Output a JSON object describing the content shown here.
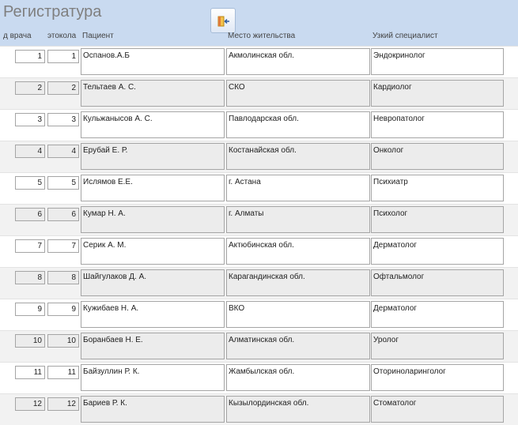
{
  "window": {
    "title": "Регистратура"
  },
  "toolbar": {
    "exit_icon": "exit-door-icon"
  },
  "columns": {
    "doctor": "д врача",
    "protocol": "этокола",
    "patient": "Пациент",
    "residence": "Место жительства",
    "specialist": "Узкий специалист"
  },
  "rows": [
    {
      "doctor": "1",
      "protocol": "1",
      "patient": "Оспанов.А.Б",
      "residence": "Акмолинская обл.",
      "specialist": "Эндокринолог"
    },
    {
      "doctor": "2",
      "protocol": "2",
      "patient": "Тельтаев А. С.",
      "residence": "СКО",
      "specialist": "Кардиолог"
    },
    {
      "doctor": "3",
      "protocol": "3",
      "patient": "Кульжанысов А. С.",
      "residence": "Павлодарская обл.",
      "specialist": "Невропатолог"
    },
    {
      "doctor": "4",
      "protocol": "4",
      "patient": "Ерубай Е. Р.",
      "residence": "Костанайская обл.",
      "specialist": "Онколог"
    },
    {
      "doctor": "5",
      "protocol": "5",
      "patient": "Ислямов Е.Е.",
      "residence": "г. Астана",
      "specialist": "Психиатр"
    },
    {
      "doctor": "6",
      "protocol": "6",
      "patient": "Кумар Н. А.",
      "residence": "г. Алматы",
      "specialist": "Психолог"
    },
    {
      "doctor": "7",
      "protocol": "7",
      "patient": "Серик А. М.",
      "residence": "Актюбинская обл.",
      "specialist": "Дерматолог"
    },
    {
      "doctor": "8",
      "protocol": "8",
      "patient": "Шайгулаков Д. А.",
      "residence": "Карагандинская обл.",
      "specialist": "Офтальмолог"
    },
    {
      "doctor": "9",
      "protocol": "9",
      "patient": "Кужибаев Н. А.",
      "residence": "ВКО",
      "specialist": "Дерматолог"
    },
    {
      "doctor": "10",
      "protocol": "10",
      "patient": "Боранбаев Н. Е.",
      "residence": "Алматинская обл.",
      "specialist": "Уролог"
    },
    {
      "doctor": "11",
      "protocol": "11",
      "patient": "Байзуллин Р. К.",
      "residence": "Жамбылская обл.",
      "specialist": "Оториноларинголог"
    },
    {
      "doctor": "12",
      "protocol": "12",
      "patient": "Бариев Р. К.",
      "residence": "Кызылординская обл.",
      "specialist": "Стоматолог"
    }
  ]
}
